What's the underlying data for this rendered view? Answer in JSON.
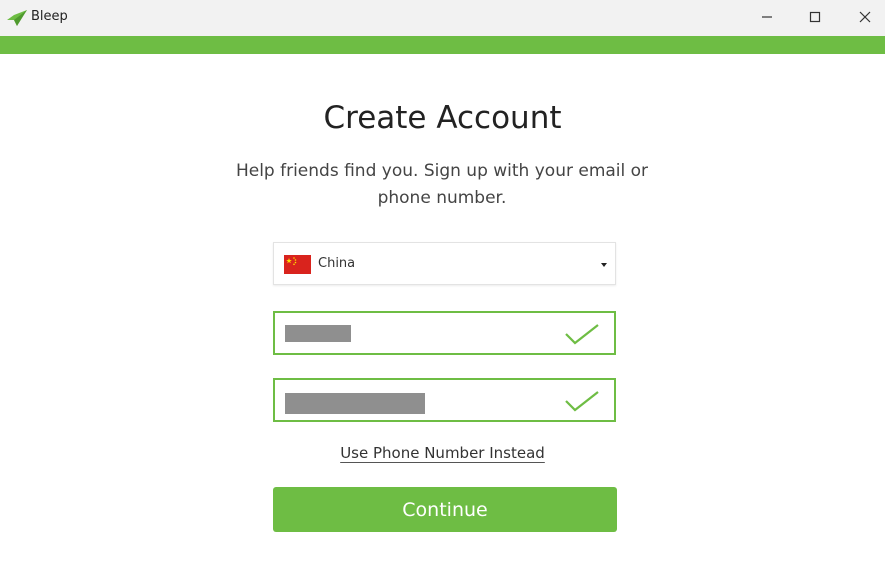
{
  "window": {
    "title": "Bleep",
    "controls": {
      "minimize_icon": "minimize-icon",
      "maximize_icon": "maximize-icon",
      "close_icon": "close-icon"
    }
  },
  "colors": {
    "accent": "#6ebd44",
    "titlebar": "#f2f2f2",
    "flag": "#d9231d"
  },
  "form": {
    "heading": "Create Account",
    "subtitle": "Help friends find you. Sign up with your email or phone number.",
    "country": {
      "selected": "China",
      "flag_icon": "china-flag-icon"
    },
    "fields": [
      {
        "value": "",
        "valid": true
      },
      {
        "value": "",
        "valid": true
      }
    ],
    "alt_link": "Use Phone Number Instead",
    "continue_label": "Continue"
  }
}
